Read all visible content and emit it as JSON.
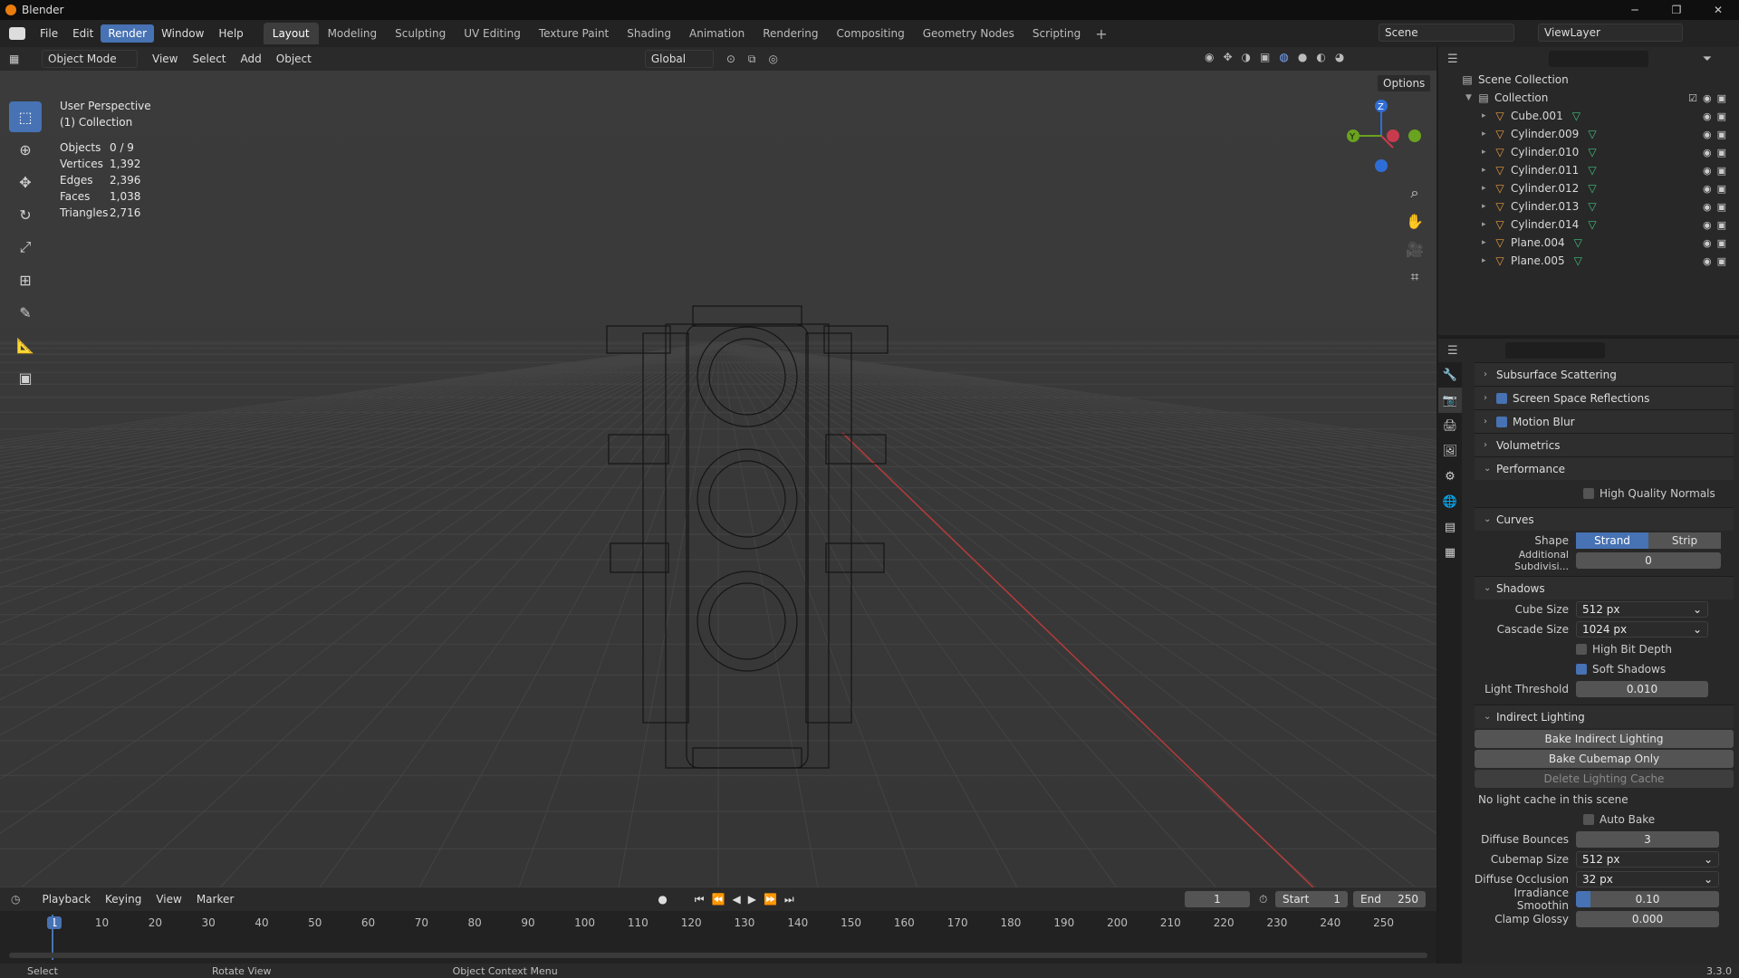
{
  "window": {
    "title": "Blender",
    "controls": [
      "─",
      "❐",
      "✕"
    ]
  },
  "menu": [
    "File",
    "Edit",
    "Render",
    "Window",
    "Help"
  ],
  "menu_active": "Render",
  "workspaces": [
    "Layout",
    "Modeling",
    "Sculpting",
    "UV Editing",
    "Texture Paint",
    "Shading",
    "Animation",
    "Rendering",
    "Compositing",
    "Geometry Nodes",
    "Scripting"
  ],
  "workspace_active": "Layout",
  "scene": "Scene",
  "viewlayer": "ViewLayer",
  "viewport_header": {
    "mode": "Object Mode",
    "menus": [
      "View",
      "Select",
      "Add",
      "Object"
    ],
    "orientation": "Global",
    "options": "Options"
  },
  "overlay": {
    "perspective": "User Perspective",
    "collection": "(1) Collection",
    "stats": [
      {
        "k": "Objects",
        "v": "0 / 9"
      },
      {
        "k": "Vertices",
        "v": "1,392"
      },
      {
        "k": "Edges",
        "v": "2,396"
      },
      {
        "k": "Faces",
        "v": "1,038"
      },
      {
        "k": "Triangles",
        "v": "2,716"
      }
    ]
  },
  "gizmo": {
    "z": "Z",
    "y": "Y"
  },
  "outliner": {
    "root": "Scene Collection",
    "collection": "Collection",
    "items": [
      "Cube.001",
      "Cylinder.009",
      "Cylinder.010",
      "Cylinder.011",
      "Cylinder.012",
      "Cylinder.013",
      "Cylinder.014",
      "Plane.004",
      "Plane.005"
    ]
  },
  "properties": {
    "sections": {
      "sss": "Subsurface Scattering",
      "ssr": "Screen Space Reflections",
      "mb": "Motion Blur",
      "vol": "Volumetrics",
      "perf": "Performance",
      "curves": "Curves",
      "shadows": "Shadows",
      "indirect": "Indirect Lighting"
    },
    "hq_normals": "High Quality Normals",
    "shape_label": "Shape",
    "shape_opts": [
      "Strand",
      "Strip"
    ],
    "subdiv_label": "Additional Subdivisi...",
    "subdiv_value": "0",
    "cube_size_label": "Cube Size",
    "cube_size": "512 px",
    "cascade_label": "Cascade Size",
    "cascade_size": "1024 px",
    "high_bit": "High Bit Depth",
    "soft_shadows": "Soft Shadows",
    "light_thr_label": "Light Threshold",
    "light_thr": "0.010",
    "bake_indirect": "Bake Indirect Lighting",
    "bake_cubemap": "Bake Cubemap Only",
    "delete_cache": "Delete Lighting Cache",
    "no_cache": "No light cache in this scene",
    "auto_bake": "Auto Bake",
    "diffuse_bounces_label": "Diffuse Bounces",
    "diffuse_bounces": "3",
    "cubemap_size_label": "Cubemap Size",
    "cubemap_size": "512 px",
    "diffuse_occ_label": "Diffuse Occlusion",
    "diffuse_occ": "32 px",
    "irr_smooth_label": "Irradiance Smoothin",
    "irr_smooth": "0.10",
    "clamp_glossy_label": "Clamp Glossy",
    "clamp_glossy": "0.000"
  },
  "timeline": {
    "menus": [
      "Playback",
      "Keying",
      "View",
      "Marker"
    ],
    "current": "1",
    "start_label": "Start",
    "start": "1",
    "end_label": "End",
    "end": "250",
    "ticks": [
      "1",
      "10",
      "20",
      "30",
      "40",
      "50",
      "60",
      "70",
      "80",
      "90",
      "100",
      "110",
      "120",
      "130",
      "140",
      "150",
      "160",
      "170",
      "180",
      "190",
      "200",
      "210",
      "220",
      "230",
      "240",
      "250"
    ]
  },
  "status": {
    "select": "Select",
    "rotate": "Rotate View",
    "context": "Object Context Menu",
    "version": "3.3.0"
  }
}
